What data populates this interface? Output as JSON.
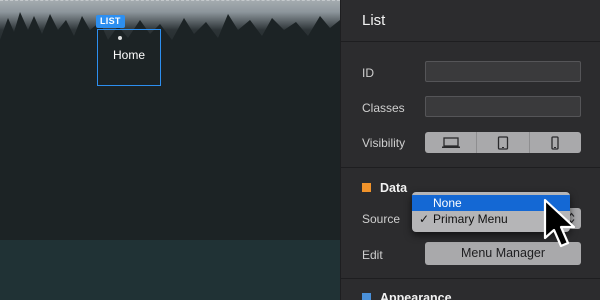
{
  "canvas": {
    "list_tag": "LIST",
    "list_item": "Home"
  },
  "panel": {
    "title": "List",
    "fields": {
      "id_label": "ID",
      "classes_label": "Classes",
      "visibility_label": "Visibility",
      "id_value": "",
      "classes_value": ""
    },
    "visibility_options": [
      "desktop-icon",
      "tablet-icon",
      "phone-icon"
    ],
    "data_section": {
      "title": "Data",
      "color": "#f0932b",
      "source_label": "Source",
      "source_value": "Primary Menu",
      "edit_label": "Edit",
      "edit_button": "Menu Manager"
    },
    "appearance_section": {
      "title": "Appearance",
      "color": "#4a90d9"
    }
  },
  "dropdown": {
    "options": [
      "None",
      "Primary Menu"
    ],
    "highlighted": "None",
    "checked": "Primary Menu",
    "highlight_color": "#1468d4"
  }
}
